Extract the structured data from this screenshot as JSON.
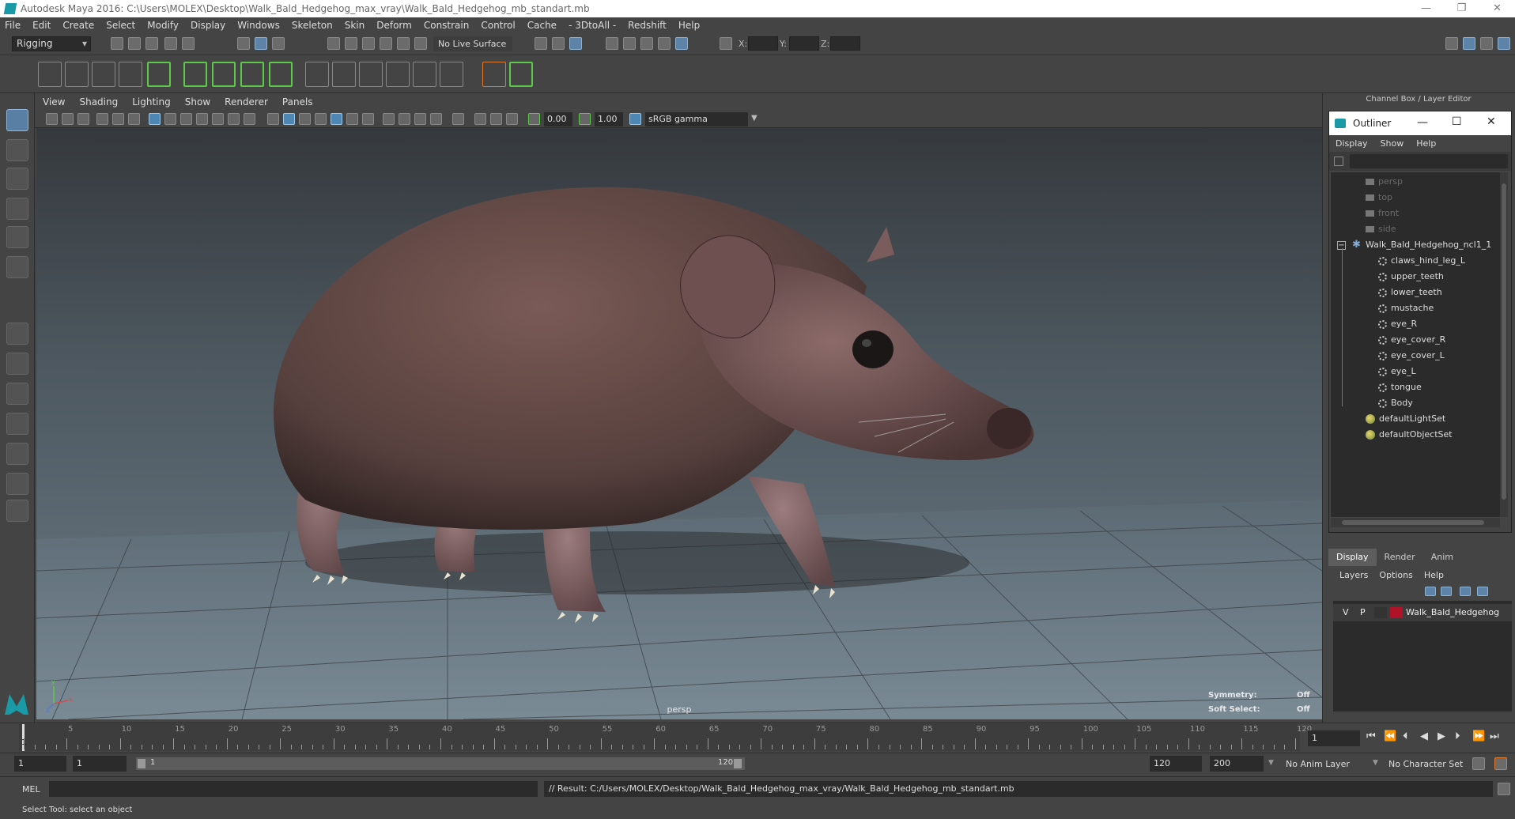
{
  "window": {
    "title": "Autodesk Maya 2016: C:\\Users\\MOLEX\\Desktop\\Walk_Bald_Hedgehog_max_vray\\Walk_Bald_Hedgehog_mb_standart.mb",
    "minimize": "—",
    "maximize": "❐",
    "close": "✕"
  },
  "menubar": [
    "File",
    "Edit",
    "Create",
    "Select",
    "Modify",
    "Display",
    "Windows",
    "Skeleton",
    "Skin",
    "Deform",
    "Constrain",
    "Control",
    "Cache",
    "- 3DtoAll -",
    "Redshift",
    "Help"
  ],
  "statusline": {
    "mode": "Rigging",
    "live_surface": "No Live Surface",
    "x_label": "X:",
    "y_label": "Y:",
    "z_label": "Z:"
  },
  "panel_menu": [
    "View",
    "Shading",
    "Lighting",
    "Show",
    "Renderer",
    "Panels"
  ],
  "panel_toolbar": {
    "exposure": "0.00",
    "gamma": "1.00",
    "color_space": "sRGB gamma"
  },
  "viewport": {
    "camera_label": "persp",
    "symmetry_label": "Symmetry:",
    "symmetry_value": "Off",
    "soft_select_label": "Soft Select:",
    "soft_select_value": "Off",
    "axis_x": "x",
    "axis_y": "y",
    "axis_z": "z"
  },
  "right_panel": {
    "header": "Channel Box / Layer Editor"
  },
  "outliner": {
    "title": "Outliner",
    "menu": [
      "Display",
      "Show",
      "Help"
    ],
    "items": [
      {
        "label": "persp",
        "type": "camera",
        "dim": true
      },
      {
        "label": "top",
        "type": "camera",
        "dim": true
      },
      {
        "label": "front",
        "type": "camera",
        "dim": true
      },
      {
        "label": "side",
        "type": "camera",
        "dim": true
      },
      {
        "label": "Walk_Bald_Hedgehog_ncl1_1",
        "type": "group",
        "dim": false
      },
      {
        "label": "claws_hind_leg_L",
        "type": "mesh",
        "dim": false
      },
      {
        "label": "upper_teeth",
        "type": "mesh",
        "dim": false
      },
      {
        "label": "lower_teeth",
        "type": "mesh",
        "dim": false
      },
      {
        "label": "mustache",
        "type": "mesh",
        "dim": false
      },
      {
        "label": "eye_R",
        "type": "mesh",
        "dim": false
      },
      {
        "label": "eye_cover_R",
        "type": "mesh",
        "dim": false
      },
      {
        "label": "eye_cover_L",
        "type": "mesh",
        "dim": false
      },
      {
        "label": "eye_L",
        "type": "mesh",
        "dim": false
      },
      {
        "label": "tongue",
        "type": "mesh",
        "dim": false
      },
      {
        "label": "Body",
        "type": "mesh",
        "dim": false
      },
      {
        "label": "defaultLightSet",
        "type": "set",
        "dim": false
      },
      {
        "label": "defaultObjectSet",
        "type": "set",
        "dim": false
      }
    ]
  },
  "layer_editor": {
    "tabs": [
      "Display",
      "Render",
      "Anim"
    ],
    "menu": [
      "Layers",
      "Options",
      "Help"
    ],
    "layer": {
      "v": "V",
      "p": "P",
      "name": "Walk_Bald_Hedgehog",
      "color": "#b0122a"
    }
  },
  "timeline": {
    "ticks": [
      "1",
      "5",
      "10",
      "15",
      "20",
      "25",
      "30",
      "35",
      "40",
      "45",
      "50",
      "55",
      "60",
      "65",
      "70",
      "75",
      "80",
      "85",
      "90",
      "95",
      "100",
      "105",
      "110",
      "115",
      "120"
    ],
    "current_frame": "1"
  },
  "range": {
    "start": "1",
    "playback_start": "1",
    "range_start_label": "1",
    "range_end_label": "120",
    "playback_end": "120",
    "end": "200",
    "anim_layer": "No Anim Layer",
    "character_set": "No Character Set"
  },
  "command_line": {
    "lang": "MEL",
    "result": "// Result: C:/Users/MOLEX/Desktop/Walk_Bald_Hedgehog_max_vray/Walk_Bald_Hedgehog_mb_standart.mb"
  },
  "help_line": "Select Tool: select an object",
  "colors": {
    "accent_blue": "#5a7fa4",
    "layer_red": "#b0122a",
    "maya_teal": "#1a9aa6"
  }
}
